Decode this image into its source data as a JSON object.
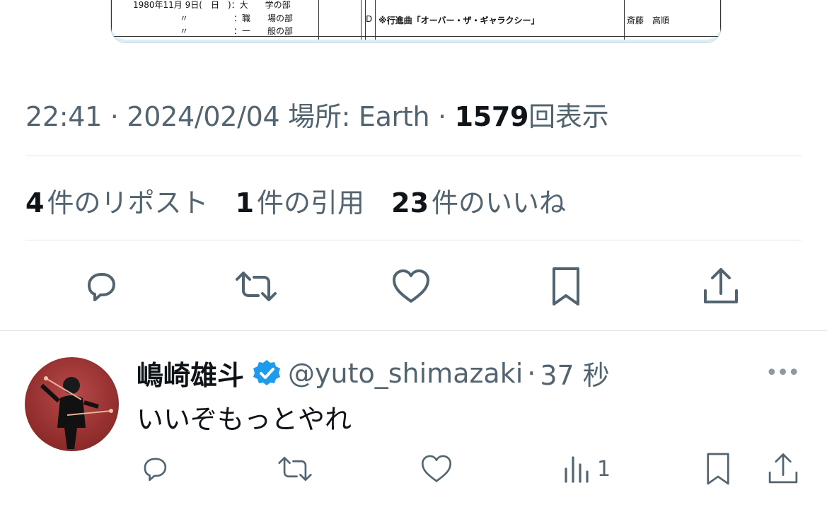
{
  "attachment": {
    "row1_date": "1980年11月 9日(　日　)：大　　学の部",
    "row2_ditto": "〃",
    "row2_cat": "：職　　場の部",
    "row3_ditto": "〃",
    "row3_cat": "：一　　般の部",
    "code": "D",
    "piece": "※行進曲「オーバー・ザ・ギャラクシー」",
    "composer": "斎藤　高順"
  },
  "tweet_meta": {
    "time": "22:41",
    "date": "2024/02/04",
    "location": "場所: Earth",
    "views_count": "1579",
    "views_label": "回表示"
  },
  "stats": {
    "reposts_count": "4",
    "reposts_label": "件のリポスト",
    "quotes_count": "1",
    "quotes_label": "件の引用",
    "likes_count": "23",
    "likes_label": "件のいいね"
  },
  "reply": {
    "display_name": "嶋崎雄斗",
    "handle": "@yuto_shimazaki",
    "time": "37 秒",
    "text": "いいぞもっとやれ",
    "view_count": "1",
    "more": "•••"
  },
  "colors": {
    "secondary_text": "#536471",
    "divider": "#e1e8ed",
    "verified": "#1d9bf0"
  },
  "icons": [
    "reply-icon",
    "repost-icon",
    "like-icon",
    "bookmark-icon",
    "share-icon",
    "verified-badge-icon",
    "analytics-icon",
    "more-icon"
  ]
}
